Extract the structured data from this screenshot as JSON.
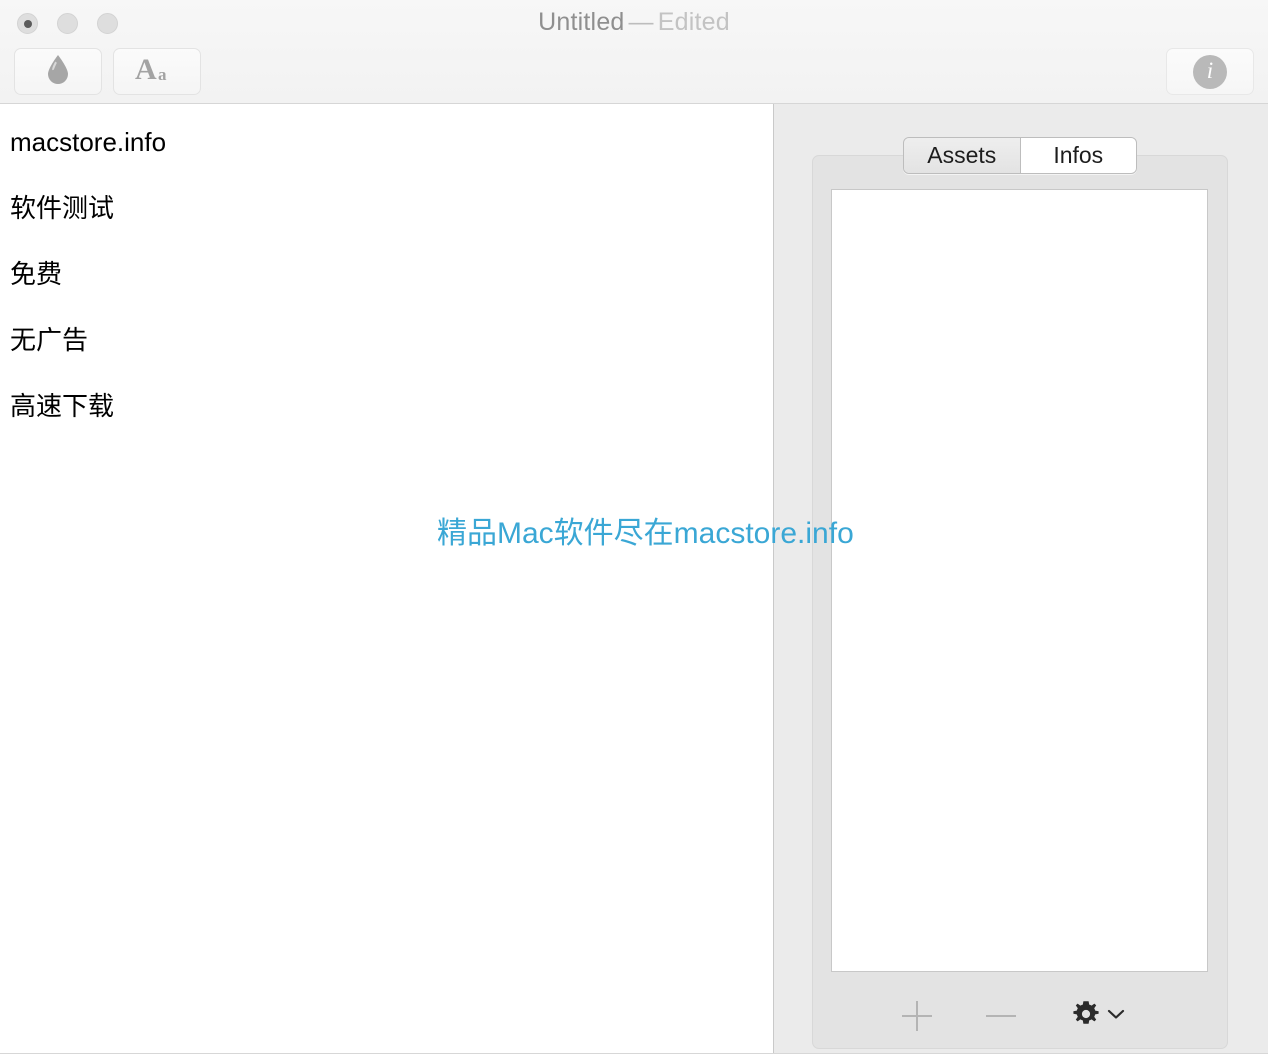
{
  "window": {
    "title_document": "Untitled",
    "title_separator": "—",
    "title_status": "Edited",
    "traffic_lights": [
      {
        "name": "close",
        "label": "Close"
      },
      {
        "name": "minimize",
        "label": "Minimize"
      },
      {
        "name": "zoom",
        "label": "Zoom"
      }
    ]
  },
  "toolbar": {
    "ink_button_icon": "ink-drop-icon",
    "ink_button_label": "Colors",
    "fonts_button_icon": "font-aa-icon",
    "fonts_button_label": "Fonts",
    "info_button_icon": "info-circle-icon",
    "info_button_label": "Info"
  },
  "document": {
    "lines": [
      "macstore.info",
      "软件测试",
      "免费",
      "无广告",
      "高速下载"
    ]
  },
  "watermark": {
    "text": "精品Mac软件尽在macstore.info",
    "color": "#3aa7d5"
  },
  "inspector": {
    "tabs": [
      {
        "label": "Assets",
        "selected": false
      },
      {
        "label": "Infos",
        "selected": true
      }
    ],
    "content_well_text": "",
    "footer": {
      "add_label": "+",
      "remove_label": "−",
      "gear_icon": "gear-icon",
      "gear_menu_icon": "chevron-down-icon"
    }
  },
  "colors": {
    "toolbar_bg": "#f4f4f4",
    "sidebar_bg": "#ebebeb",
    "panel_bg": "#e3e3e3",
    "well_bg": "#ffffff",
    "divider": "#c9c9c9",
    "watermark": "#3aa7d5",
    "title_text": "#9a9a9a"
  }
}
